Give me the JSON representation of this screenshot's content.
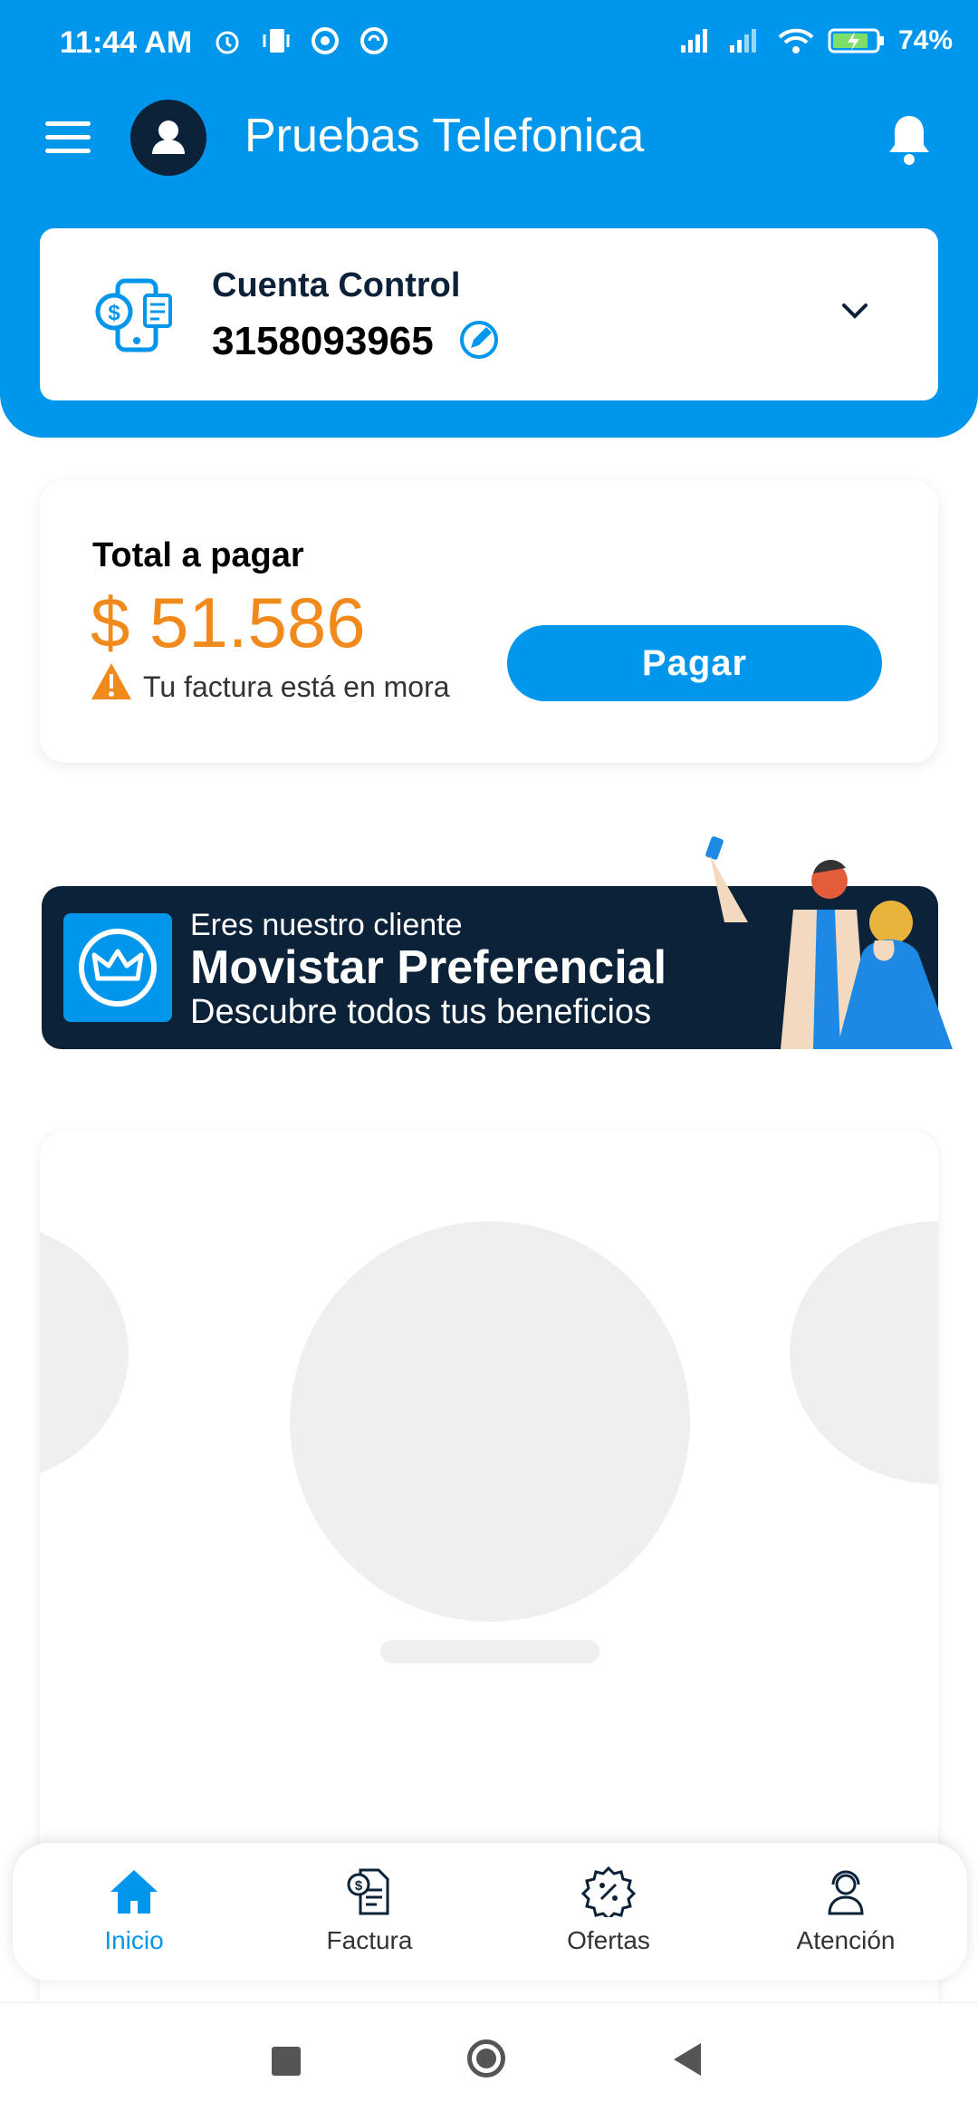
{
  "status_bar": {
    "time": "11:44 AM",
    "battery": "74%",
    "left_icons": [
      "alarm-icon",
      "phone-vibrate-icon",
      "chrome-icon",
      "sync-icon"
    ],
    "right_icons": [
      "signal-icon",
      "signal-icon",
      "wifi-icon",
      "battery-charging-icon"
    ]
  },
  "header": {
    "title": "Pruebas Telefonica",
    "menu_icon": "hamburger-menu-icon",
    "avatar_icon": "user-icon",
    "notifications_icon": "bell-icon"
  },
  "account": {
    "type": "Cuenta Control",
    "number": "3158093965",
    "icon": "phone-bill-icon"
  },
  "payment": {
    "label": "Total a pagar",
    "amount": "$ 51.586",
    "warning": "Tu factura está en mora",
    "button": "Pagar"
  },
  "banner": {
    "line1": "Eres nuestro cliente",
    "line2": "Movistar Preferencial",
    "line3": "Descubre todos tus beneficios",
    "icon": "crown-icon"
  },
  "bottom_nav": [
    {
      "label": "Inicio",
      "icon": "home-icon",
      "active": true
    },
    {
      "label": "Factura",
      "icon": "invoice-icon",
      "active": false
    },
    {
      "label": "Ofertas",
      "icon": "discount-badge-icon",
      "active": false
    },
    {
      "label": "Atención",
      "icon": "support-agent-icon",
      "active": false
    }
  ],
  "colors": {
    "primary": "#0096eb",
    "navy": "#0b2239",
    "amount": "#f08a1c",
    "warning": "#f08a1c"
  }
}
